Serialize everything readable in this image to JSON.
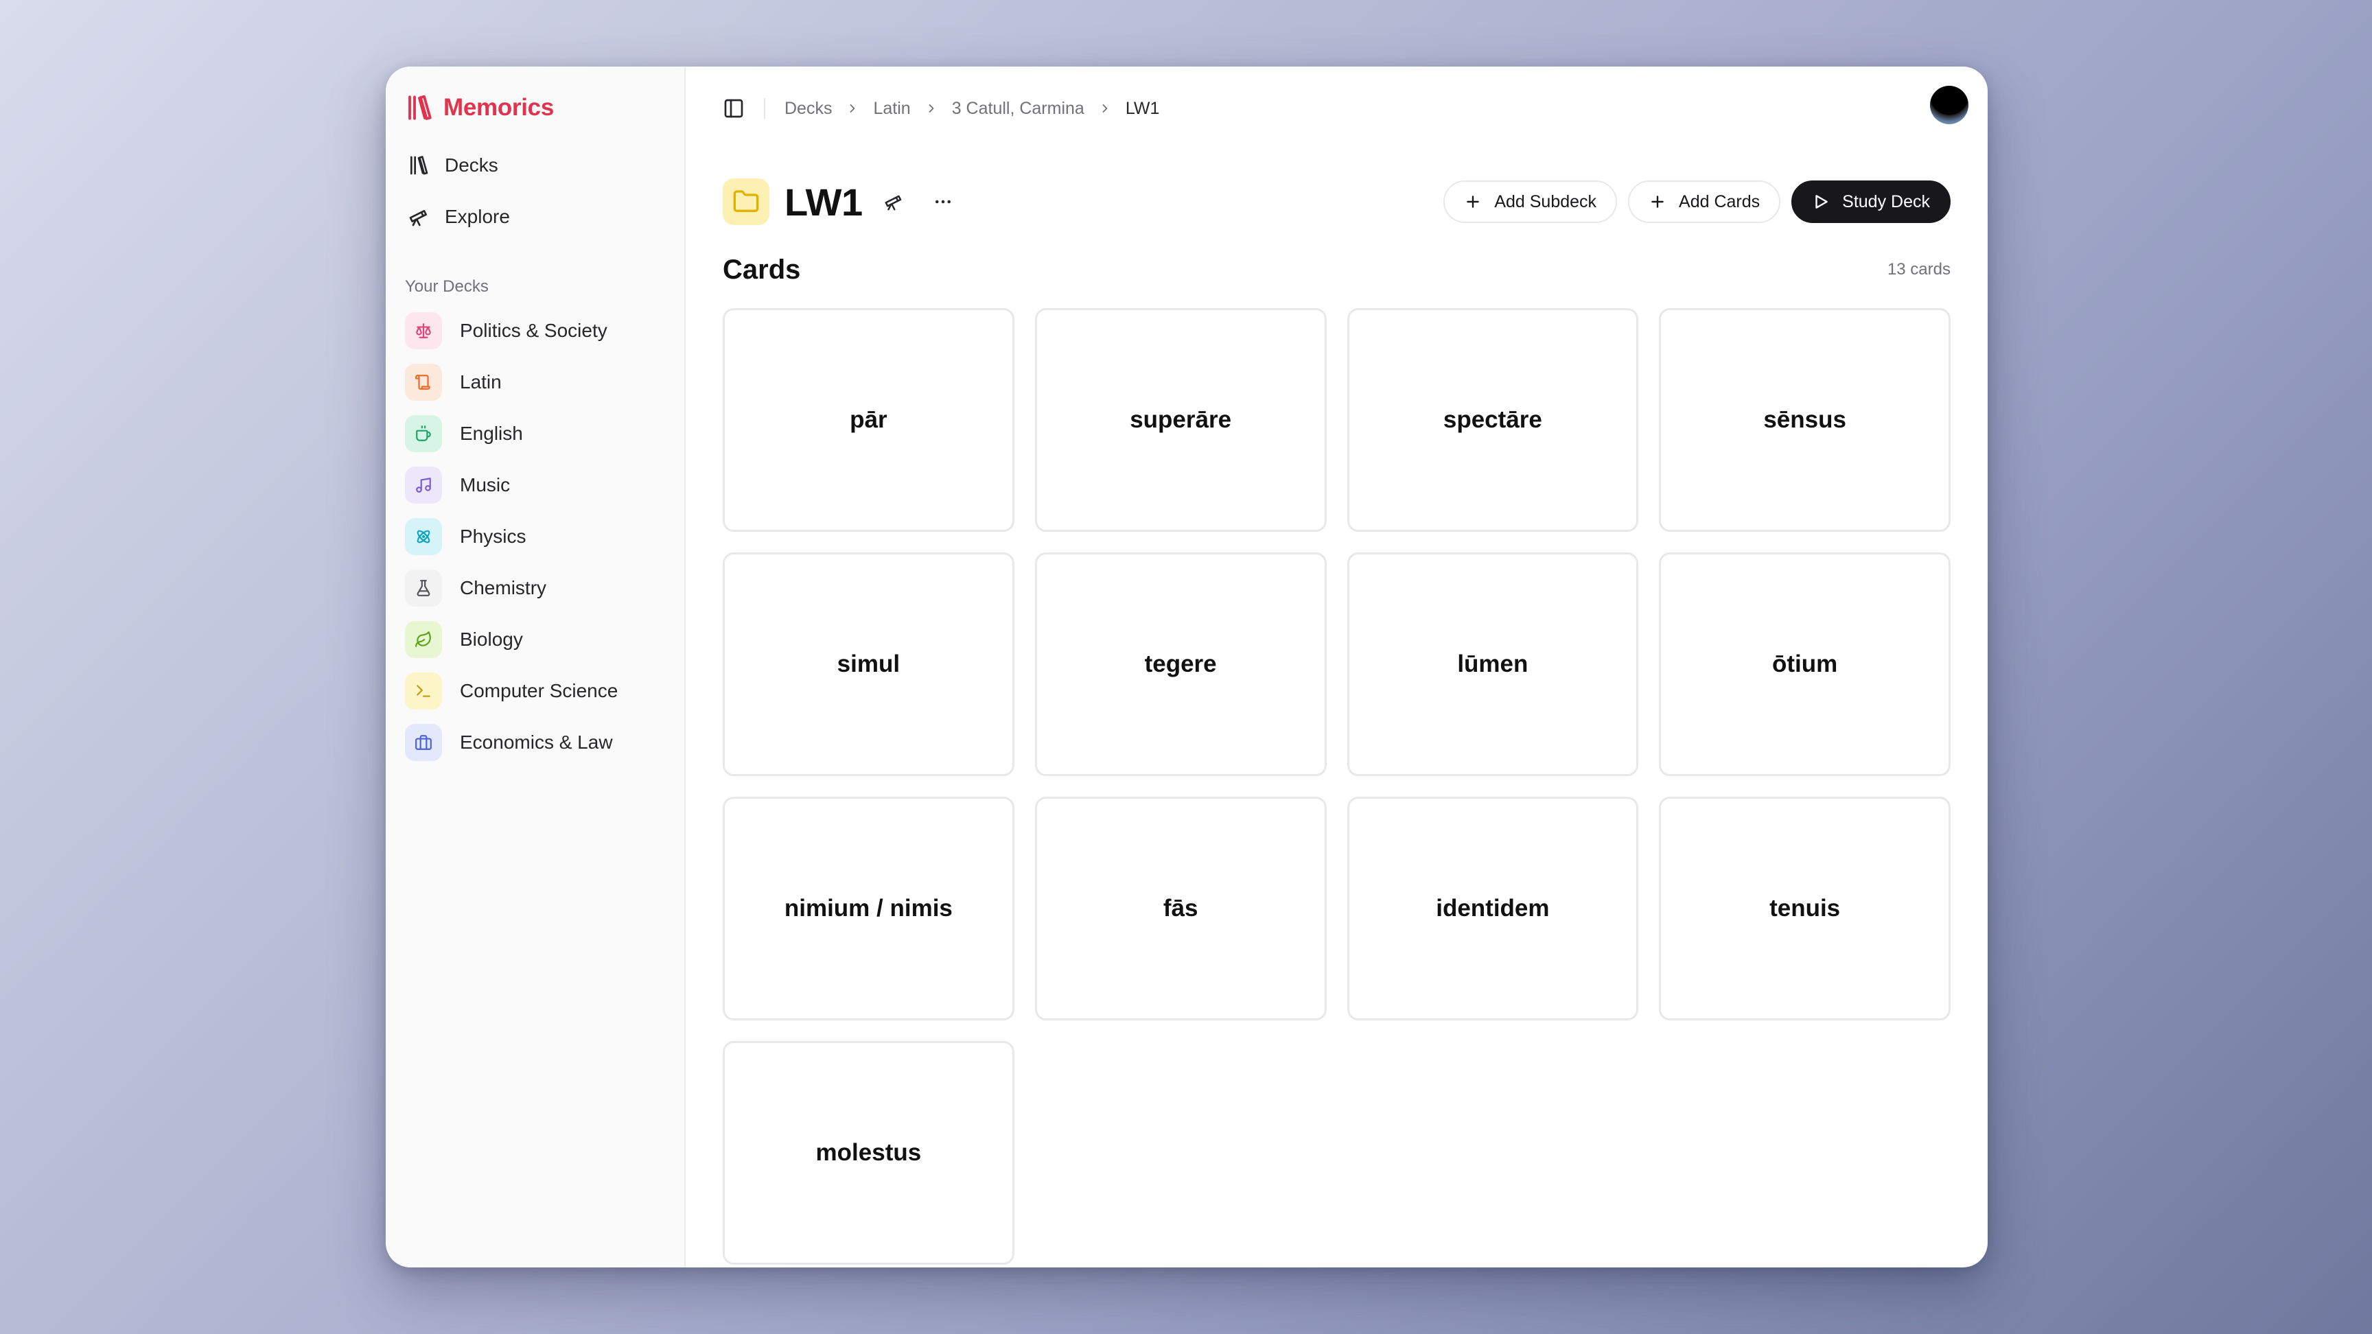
{
  "brand": {
    "name": "Memorics",
    "color": "#e0344e"
  },
  "nav": [
    {
      "label": "Decks",
      "icon": "library-icon"
    },
    {
      "label": "Explore",
      "icon": "telescope-icon"
    }
  ],
  "sidebar": {
    "section_label": "Your Decks",
    "decks": [
      {
        "label": "Politics & Society",
        "icon": "scale-icon",
        "bg": "#fde7ef",
        "fg": "#e0447a"
      },
      {
        "label": "Latin",
        "icon": "scroll-icon",
        "bg": "#fde9dc",
        "fg": "#ea6a2a"
      },
      {
        "label": "English",
        "icon": "coffee-icon",
        "bg": "#d7f5e6",
        "fg": "#1fa36a"
      },
      {
        "label": "Music",
        "icon": "music-icon",
        "bg": "#ece7fb",
        "fg": "#7c5ad6"
      },
      {
        "label": "Physics",
        "icon": "atom-icon",
        "bg": "#d6f4f8",
        "fg": "#0ea5c0"
      },
      {
        "label": "Chemistry",
        "icon": "flask-icon",
        "bg": "#f2f2f3",
        "fg": "#52525b"
      },
      {
        "label": "Biology",
        "icon": "leaf-icon",
        "bg": "#e8f7d2",
        "fg": "#5aa417"
      },
      {
        "label": "Computer Science",
        "icon": "terminal-icon",
        "bg": "#fcf5c8",
        "fg": "#c29a05"
      },
      {
        "label": "Economics & Law",
        "icon": "briefcase-icon",
        "bg": "#e4e8fb",
        "fg": "#4b63d6"
      }
    ]
  },
  "breadcrumb": [
    "Decks",
    "Latin",
    "3 Catull, Carmina",
    "LW1"
  ],
  "deck": {
    "title": "LW1"
  },
  "actions": {
    "add_subdeck": "Add Subdeck",
    "add_cards": "Add Cards",
    "study_deck": "Study Deck"
  },
  "cards_section": {
    "title": "Cards",
    "count": "13 cards"
  },
  "cards": [
    "pār",
    "superāre",
    "spectāre",
    "sēnsus",
    "simul",
    "tegere",
    "lūmen",
    "ōtium",
    "nimium / nimis",
    "fās",
    "identidem",
    "tenuis",
    "molestus"
  ]
}
